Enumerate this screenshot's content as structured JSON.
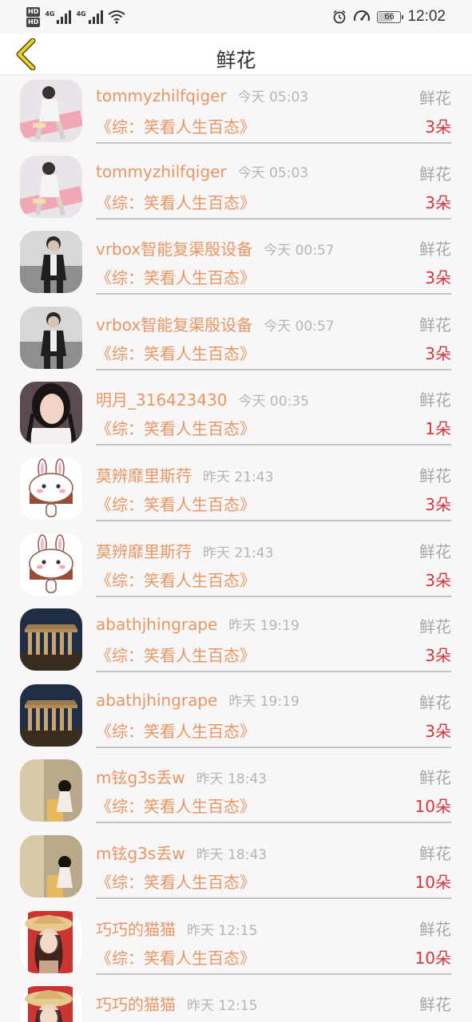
{
  "status_bar": {
    "hd1": "HD",
    "hd2": "HD",
    "net1": "4G",
    "net2": "4G",
    "battery": "66",
    "battery_level": 0.66,
    "time": "12:02"
  },
  "nav": {
    "title": "鲜花"
  },
  "records": [
    {
      "user": "tommyzhilfqiger",
      "time": "今天 05:03",
      "type": "鲜花",
      "book": "《综：笑看人生百态》",
      "count": "3朵",
      "avatar": "avatar-girl"
    },
    {
      "user": "tommyzhilfqiger",
      "time": "今天 05:03",
      "type": "鲜花",
      "book": "《综：笑看人生百态》",
      "count": "3朵",
      "avatar": "avatar-girl"
    },
    {
      "user": "vrbox智能复渠殷设备",
      "time": "今天 00:57",
      "type": "鲜花",
      "book": "《综：笑看人生百态》",
      "count": "3朵",
      "avatar": "avatar-man"
    },
    {
      "user": "vrbox智能复渠殷设备",
      "time": "今天 00:57",
      "type": "鲜花",
      "book": "《综：笑看人生百态》",
      "count": "3朵",
      "avatar": "avatar-man"
    },
    {
      "user": "明月_316423430",
      "time": "今天 00:35",
      "type": "鲜花",
      "book": "《综：笑看人生百态》",
      "count": "1朵",
      "avatar": "avatar-woman"
    },
    {
      "user": "莫辨靡里斯荇",
      "time": "昨天 21:43",
      "type": "鲜花",
      "book": "《综：笑看人生百态》",
      "count": "3朵",
      "avatar": "avatar-bunny"
    },
    {
      "user": "莫辨靡里斯荇",
      "time": "昨天 21:43",
      "type": "鲜花",
      "book": "《综：笑看人生百态》",
      "count": "3朵",
      "avatar": "avatar-bunny"
    },
    {
      "user": "abathjhingrape",
      "time": "昨天 19:19",
      "type": "鲜花",
      "book": "《综：笑看人生百态》",
      "count": "3朵",
      "avatar": "avatar-temple"
    },
    {
      "user": "abathjhingrape",
      "time": "昨天 19:19",
      "type": "鲜花",
      "book": "《综：笑看人生百态》",
      "count": "3朵",
      "avatar": "avatar-temple"
    },
    {
      "user": "m铉g3s丢w",
      "time": "昨天 18:43",
      "type": "鲜花",
      "book": "《综：笑看人生百态》",
      "count": "10朵",
      "avatar": "avatar-room"
    },
    {
      "user": "m铉g3s丢w",
      "time": "昨天 18:43",
      "type": "鲜花",
      "book": "《综：笑看人生百态》",
      "count": "10朵",
      "avatar": "avatar-room"
    },
    {
      "user": "巧巧的猫猫",
      "time": "昨天 12:15",
      "type": "鲜花",
      "book": "《综：笑看人生百态》",
      "count": "10朵",
      "avatar": "avatar-hat"
    },
    {
      "user": "巧巧的猫猫",
      "time": "昨天 12:15",
      "type": "鲜花",
      "book": "",
      "count": "",
      "avatar": "avatar-hat"
    }
  ]
}
